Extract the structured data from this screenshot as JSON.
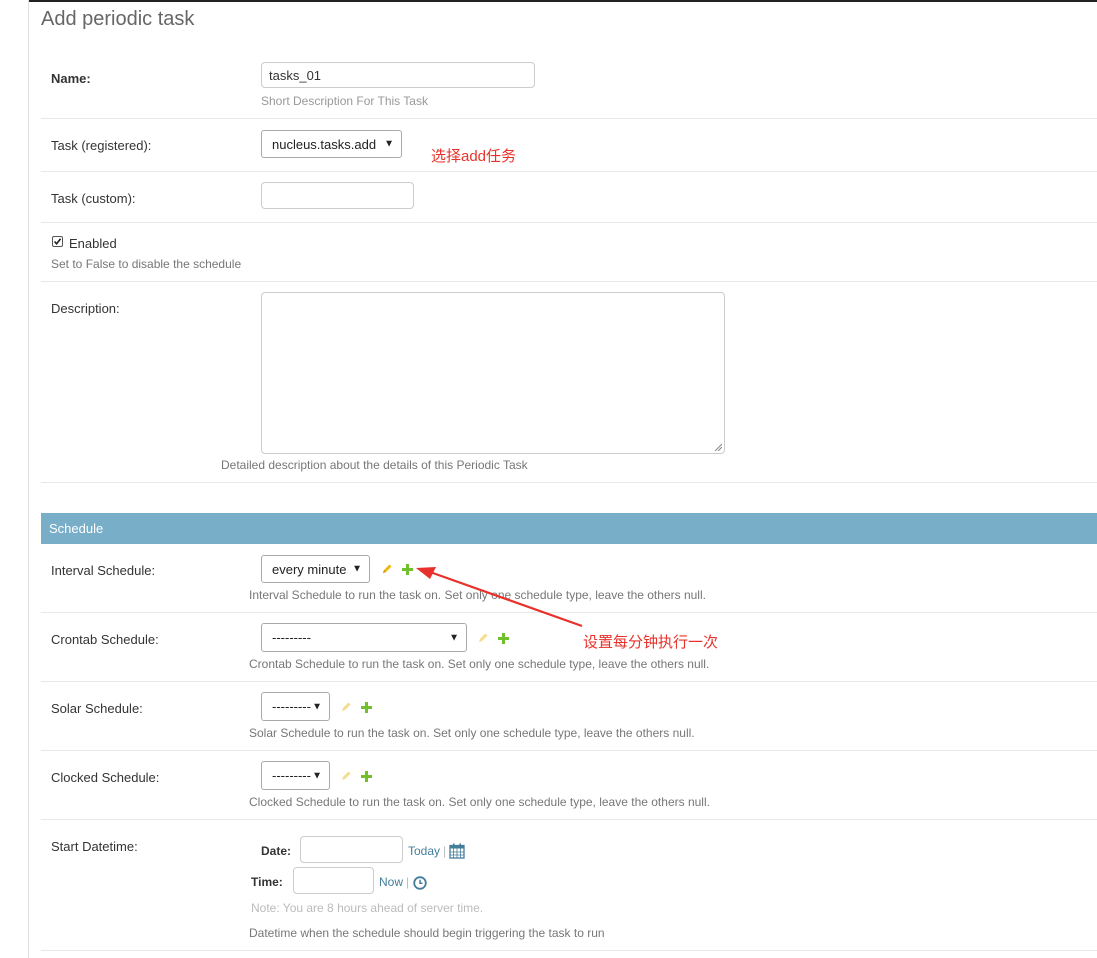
{
  "page": {
    "title": "Add periodic task"
  },
  "fields": {
    "name": {
      "label": "Name:",
      "value": "tasks_01",
      "help": "Short Description For This Task"
    },
    "task_registered": {
      "label": "Task (registered):",
      "value": "nucleus.tasks.add"
    },
    "task_custom": {
      "label": "Task (custom):",
      "value": ""
    },
    "enabled": {
      "label": "Enabled",
      "checked": true,
      "help": "Set to False to disable the schedule"
    },
    "description": {
      "label": "Description:",
      "value": "",
      "help": "Detailed description about the details of this Periodic Task"
    }
  },
  "schedule": {
    "section_title": "Schedule",
    "interval": {
      "label": "Interval Schedule:",
      "value": "every minute",
      "help": "Interval Schedule to run the task on.  Set only one schedule type, leave the others null."
    },
    "crontab": {
      "label": "Crontab Schedule:",
      "value": "---------",
      "help": "Crontab Schedule to run the task on.  Set only one schedule type, leave the others null."
    },
    "solar": {
      "label": "Solar Schedule:",
      "value": "---------",
      "help": "Solar Schedule to run the task on.  Set only one schedule type, leave the others null."
    },
    "clocked": {
      "label": "Clocked Schedule:",
      "value": "---------",
      "help": "Clocked Schedule to run the task on.  Set only one schedule type, leave the others null."
    },
    "start_datetime": {
      "label": "Start Datetime:",
      "date_label": "Date:",
      "time_label": "Time:",
      "today": "Today",
      "now": "Now",
      "separator": "|",
      "note": "Note: You are 8 hours ahead of server time.",
      "help": "Datetime when the schedule should begin triggering the task to run"
    }
  },
  "annotations": {
    "select_add": "选择add任务",
    "every_minute": "设置每分钟执行一次"
  },
  "colors": {
    "section": "#79aec8",
    "link": "#447e9b",
    "annotation": "#e8312a",
    "add_icon": "#70bf2b",
    "edit_icon": "#efb80b"
  }
}
